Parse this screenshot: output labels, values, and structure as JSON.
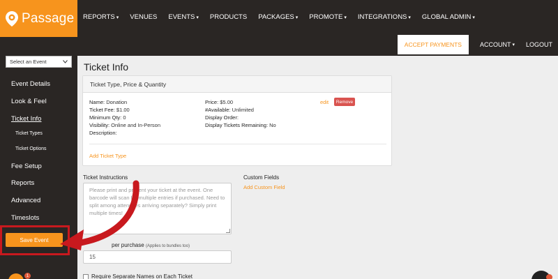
{
  "brand": {
    "name": "Passage",
    "accent": "#f7941d",
    "dark": "#2a2624",
    "alert": "#c8191e"
  },
  "nav": {
    "items": [
      {
        "label": "REPORTS",
        "caret": "▾"
      },
      {
        "label": "VENUES",
        "caret": ""
      },
      {
        "label": "EVENTS",
        "caret": "▾"
      },
      {
        "label": "PRODUCTS",
        "caret": ""
      },
      {
        "label": "PACKAGES",
        "caret": "▾"
      },
      {
        "label": "PROMOTE",
        "caret": "▾"
      },
      {
        "label": "INTEGRATIONS",
        "caret": "▾"
      },
      {
        "label": "GLOBAL ADMIN",
        "caret": "▾"
      }
    ],
    "accept_payments": "ACCEPT PAYMENTS",
    "account": "ACCOUNT",
    "account_caret": "▾",
    "logout": "LOGOUT"
  },
  "sidebar": {
    "select_event": "Select an Event",
    "items": {
      "event_details": "Event Details",
      "look_feel": "Look & Feel",
      "ticket_info": "Ticket Info",
      "ticket_types": "Ticket Types",
      "ticket_options": "Ticket Options",
      "fee_setup": "Fee Setup",
      "reports": "Reports",
      "advanced": "Advanced",
      "timeslots": "Timeslots"
    },
    "save_event": "Save Event",
    "chat_badge": "1"
  },
  "main": {
    "title": "Ticket Info",
    "card": {
      "header": "Ticket Type, Price & Quantity",
      "left": [
        {
          "k": "Name:",
          "v": "Donation"
        },
        {
          "k": "Ticket Fee:",
          "v": "$1.00"
        },
        {
          "k": "Minimum Qty:",
          "v": "0"
        },
        {
          "k": "Visibility:",
          "v": "Online and In-Person"
        },
        {
          "k": "Description:",
          "v": ""
        }
      ],
      "right": [
        {
          "k": "Price:",
          "v": "$5.00"
        },
        {
          "k": "#Available:",
          "v": "Unlimited"
        },
        {
          "k": "Display Order:",
          "v": ""
        },
        {
          "k": "Display Tickets Remaining:",
          "v": "No"
        }
      ],
      "edit": "edit",
      "remove": "Remove",
      "add_ticket_type": "Add Ticket Type"
    },
    "instructions": {
      "label": "Ticket Instructions",
      "placeholder": "Please print and present your ticket at the event. One barcode will scan for multiple entries if purchased. Need to split among attendees arriving separately? Simply print multiple times!"
    },
    "custom_fields": {
      "label": "Custom Fields",
      "add": "Add Custom Field"
    },
    "max_per_purchase": {
      "label": "per purchase",
      "note": "(Applies to bundles too)",
      "value": "15"
    },
    "require_names": "Require Separate Names on Each Ticket"
  }
}
